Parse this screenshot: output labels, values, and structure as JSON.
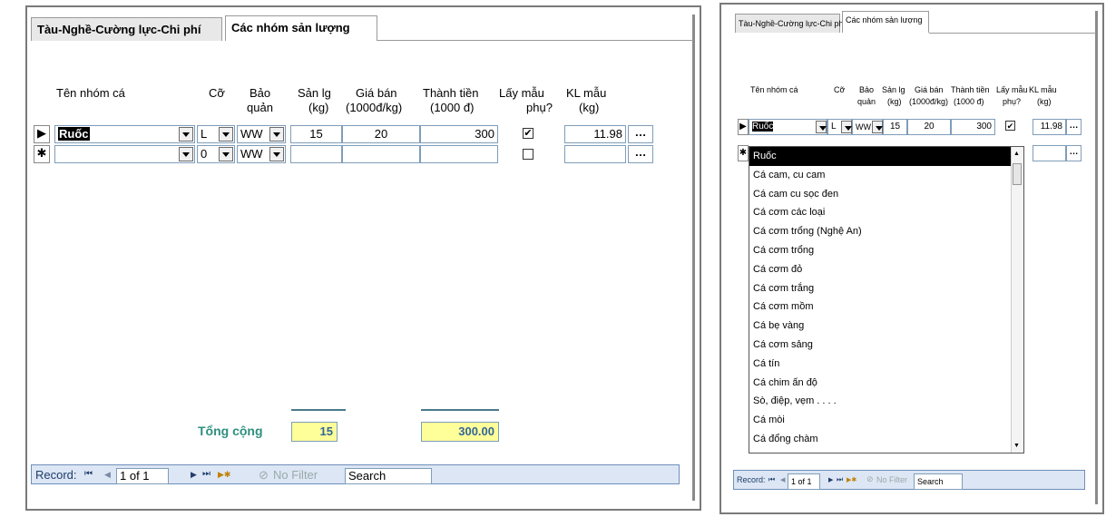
{
  "left_form": {
    "tabs": [
      {
        "label": "Tàu-Nghề-Cường lực-Chi phí",
        "active": false
      },
      {
        "label": "Các nhóm sản lượng",
        "active": true
      }
    ],
    "columns": {
      "fish_group": "Tên nhóm cá",
      "size": "Cỡ",
      "preservation_1": "Bảo",
      "preservation_2": "quản",
      "output_1": "Sản lg",
      "output_2": "(kg)",
      "price_1": "Giá bán",
      "price_2": "(1000đ/kg)",
      "amount_1": "Thành tiền",
      "amount_2": "(1000 đ)",
      "sample_1": "Lấy mẫu",
      "sample_2": "phụ?",
      "weight_1": "KL mẫu",
      "weight_2": "(kg)"
    },
    "rows": [
      {
        "selector": "▶",
        "fish_group": "Ruốc",
        "size": "L",
        "preservation": "WW",
        "output": "15",
        "price": "20",
        "amount": "300",
        "sample_checked": "✔",
        "weight": "11.98",
        "ellipsis": "…"
      },
      {
        "selector": "✱",
        "fish_group": "",
        "size": "0",
        "preservation": "WW",
        "output": "",
        "price": "",
        "amount": "",
        "sample_checked": "",
        "weight": "",
        "ellipsis": "…"
      }
    ],
    "totals": {
      "label": "Tổng cộng",
      "output_total": "15",
      "amount_total": "300.00"
    },
    "navigation": {
      "record_label": "Record:",
      "first": "⏮",
      "prev": "◀",
      "position": "1 of 1",
      "next": "▶",
      "last": "⏭",
      "new": "▶✱",
      "filter": "No Filter",
      "search": "Search"
    }
  },
  "right_form": {
    "tabs": [
      {
        "label": "Tàu-Nghề-Cường lực-Chi phí",
        "active": false
      },
      {
        "label": "Các nhóm sản lượng",
        "active": true
      }
    ],
    "columns": {
      "fish_group": "Tên nhóm cá",
      "size": "Cỡ",
      "preservation_1": "Bảo",
      "preservation_2": "quản",
      "output_1": "Sản lg",
      "output_2": "(kg)",
      "price_1": "Giá bán",
      "price_2": "(1000đ/kg)",
      "amount_1": "Thành tiền",
      "amount_2": "(1000 đ)",
      "sample_1": "Lấy mẫu",
      "sample_2": "phụ?",
      "weight_1": "KL mẫu",
      "weight_2": "(kg)"
    },
    "row": {
      "selector": "▶",
      "fish_group": "Ruốc",
      "size": "L",
      "preservation": "WW",
      "output": "15",
      "price": "20",
      "amount": "300",
      "sample_checked": "✔",
      "weight": "11.98",
      "ellipsis": "…"
    },
    "new_row": {
      "selector": "✱",
      "ellipsis": "…"
    },
    "dropdown_options": [
      "Ruốc",
      "Cá cam, cu cam",
      "Cá cam cu sọc đen",
      "Cá cơm các loại",
      "Cá cơm trổng (Nghệ An)",
      "Cá cơm trổng",
      "Cá cơm đỏ",
      "Cá cơm trắng",
      "Cá cơm mồm",
      "Cá bẹ vàng",
      "Cá cơm sảng",
      "Cá tín",
      "Cá chim ấn độ",
      "Sò, điệp, vẹm . . . .",
      "Cá mòi",
      "Cá đổng chàm"
    ],
    "dropdown_selected": "Ruốc",
    "navigation": {
      "record_label": "Record:",
      "first": "⏮",
      "prev": "◀",
      "position": "1 of 1",
      "next": "▶",
      "last": "⏭",
      "new": "▶✱",
      "filter": "No Filter",
      "search": "Search"
    }
  },
  "colors": {
    "total_fill": "#ffff99",
    "total_text": "#336699",
    "nav_bar": "#dce6f4",
    "selected_item": "#000000"
  }
}
